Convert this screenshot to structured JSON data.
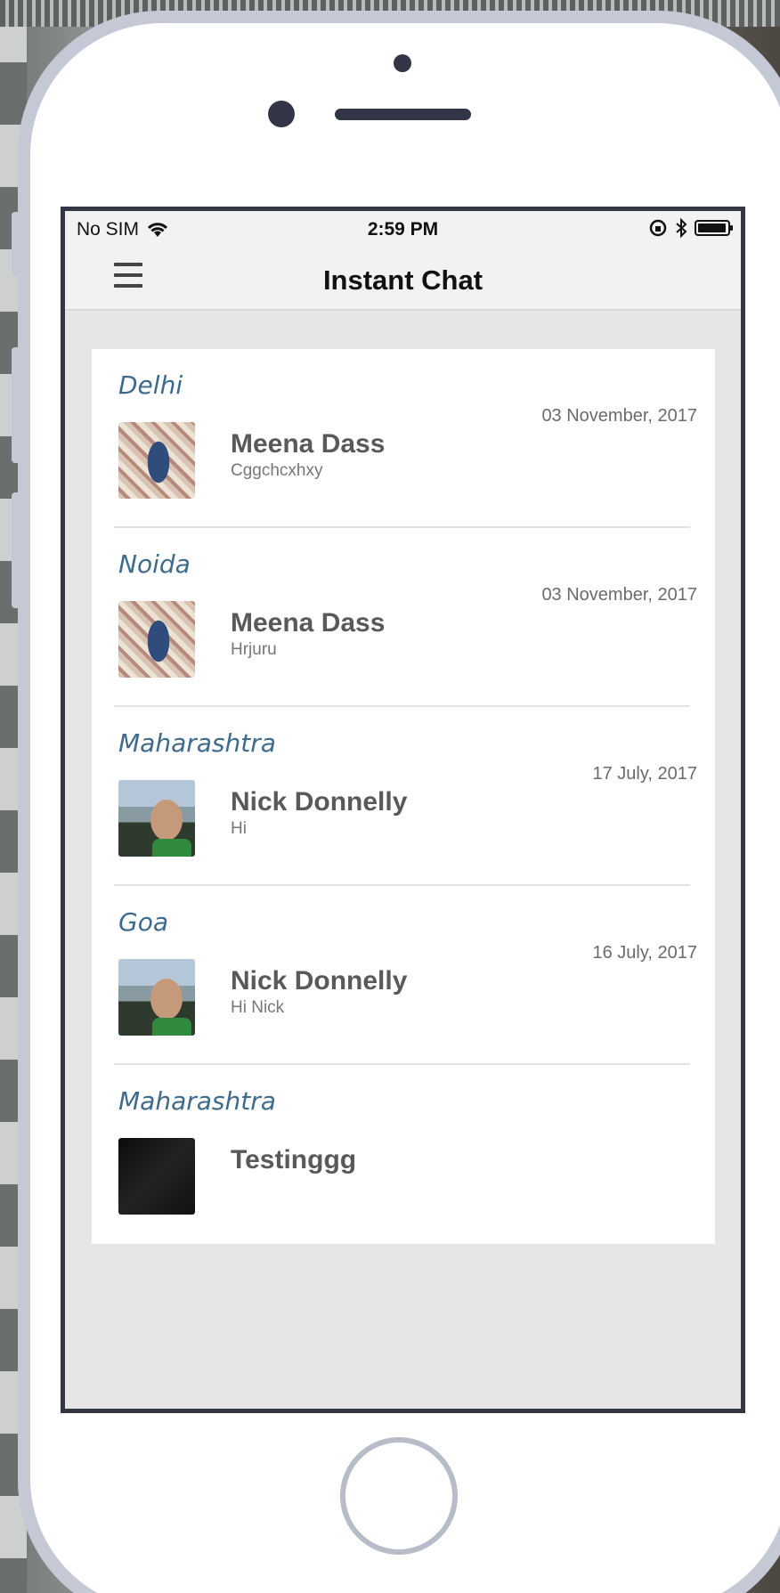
{
  "status_bar": {
    "carrier": "No SIM",
    "time": "2:59 PM"
  },
  "nav": {
    "title": "Instant Chat",
    "menu_icon": "hamburger-menu-icon"
  },
  "chats": [
    {
      "location": "Delhi",
      "name": "Meena Dass",
      "message": "Cggchcxhxy",
      "date": "03 November, 2017"
    },
    {
      "location": "Noida",
      "name": "Meena Dass",
      "message": "Hrjuru",
      "date": "03 November, 2017"
    },
    {
      "location": "Maharashtra",
      "name": "Nick Donnelly",
      "message": "Hi",
      "date": "17 July, 2017"
    },
    {
      "location": "Goa",
      "name": "Nick Donnelly",
      "message": "Hi Nick",
      "date": "16 July, 2017"
    },
    {
      "location": "Maharashtra",
      "name": "Testinggg",
      "message": "",
      "date": ""
    }
  ],
  "colors": {
    "location_text": "#3e6a8c",
    "nav_background": "#f2f2f2",
    "list_background": "#ffffff",
    "phone_frame": "#c4c9d5"
  }
}
